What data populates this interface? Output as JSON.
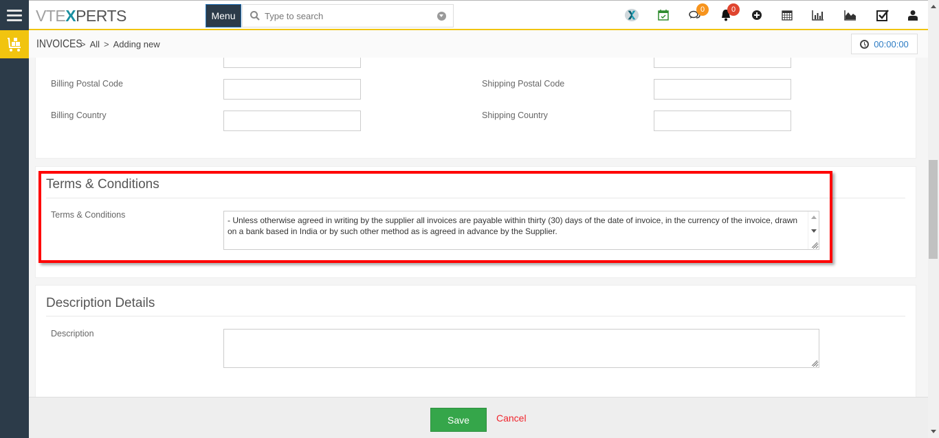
{
  "brand": {
    "logo_prefix": "VTE",
    "logo_x": "X",
    "logo_suffix": "PERTS"
  },
  "topbar": {
    "menu_label": "Menu",
    "search": {
      "placeholder": "Type to search",
      "value": ""
    },
    "icons": [
      {
        "name": "vtexperts-x-icon"
      },
      {
        "name": "calendar-check-icon"
      },
      {
        "name": "chat-icon",
        "badge": "0",
        "badge_color": "#f7941d"
      },
      {
        "name": "bell-icon",
        "badge": "0",
        "badge_color": "#e0452f"
      },
      {
        "name": "plus-circle-icon"
      },
      {
        "name": "calendar-icon"
      },
      {
        "name": "bar-chart-icon"
      },
      {
        "name": "area-chart-icon"
      },
      {
        "name": "checkbox-icon"
      },
      {
        "name": "user-icon"
      }
    ]
  },
  "breadcrumb": {
    "module": "INVOICES",
    "items": [
      "All",
      "Adding new"
    ]
  },
  "timer": {
    "value": "00:00:00"
  },
  "address_panel": {
    "billing_postal_code_label": "Billing Postal Code",
    "billing_country_label": "Billing Country",
    "shipping_postal_code_label": "Shipping Postal Code",
    "shipping_country_label": "Shipping Country",
    "billing_postal_code": "",
    "billing_country": "",
    "shipping_postal_code": "",
    "shipping_country": ""
  },
  "terms_panel": {
    "title": "Terms & Conditions",
    "field_label": "Terms & Conditions",
    "value": " - Unless otherwise agreed in writing by the supplier all invoices are payable within thirty (30) days of the date of invoice, in the currency of the invoice, drawn on a bank based in India or by such other method as is agreed in advance by the Supplier."
  },
  "description_panel": {
    "title": "Description Details",
    "field_label": "Description",
    "value": ""
  },
  "footer": {
    "save_label": "Save",
    "cancel_label": "Cancel"
  },
  "colors": {
    "accent": "#f1c40f",
    "nav_dark": "#2c3b49",
    "save_green": "#35a64a",
    "cancel_red": "#f0242c",
    "highlight_red": "#ff0000",
    "link_blue": "#2b7bc3"
  }
}
